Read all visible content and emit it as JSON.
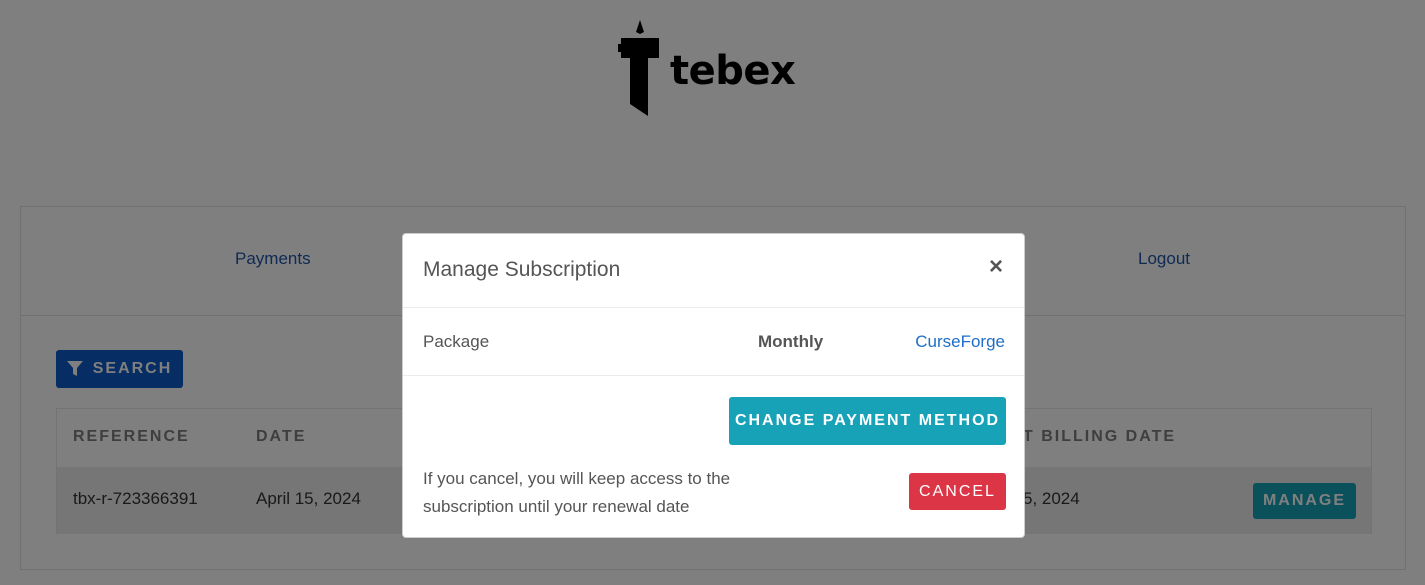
{
  "brand": {
    "name": "tebex",
    "logo_icon": "tebex-logo-icon"
  },
  "nav": {
    "items": [
      {
        "label": "Payments"
      },
      {
        "label": "Logout"
      }
    ]
  },
  "toolbar": {
    "search_label": "SEARCH",
    "search_icon": "filter-icon"
  },
  "table": {
    "columns": [
      "REFERENCE",
      "DATE",
      "T BILLING DATE"
    ],
    "rows": [
      {
        "reference": "tbx-r-723366391",
        "date": "April 15, 2024",
        "billing_date": "5, 2024",
        "action_label": "MANAGE"
      }
    ]
  },
  "modal": {
    "title": "Manage Subscription",
    "close_symbol": "×",
    "package": {
      "label": "Package",
      "period": "Monthly",
      "name": "CurseForge"
    },
    "change_payment_label": "CHANGE PAYMENT METHOD",
    "note": "If you cancel, you will keep access to the subscription until your renewal date",
    "cancel_label": "CANCEL"
  },
  "colors": {
    "primary": "#0d5ac9",
    "info": "#17a2b8",
    "danger": "#dc3545",
    "link": "#1e56a8"
  }
}
